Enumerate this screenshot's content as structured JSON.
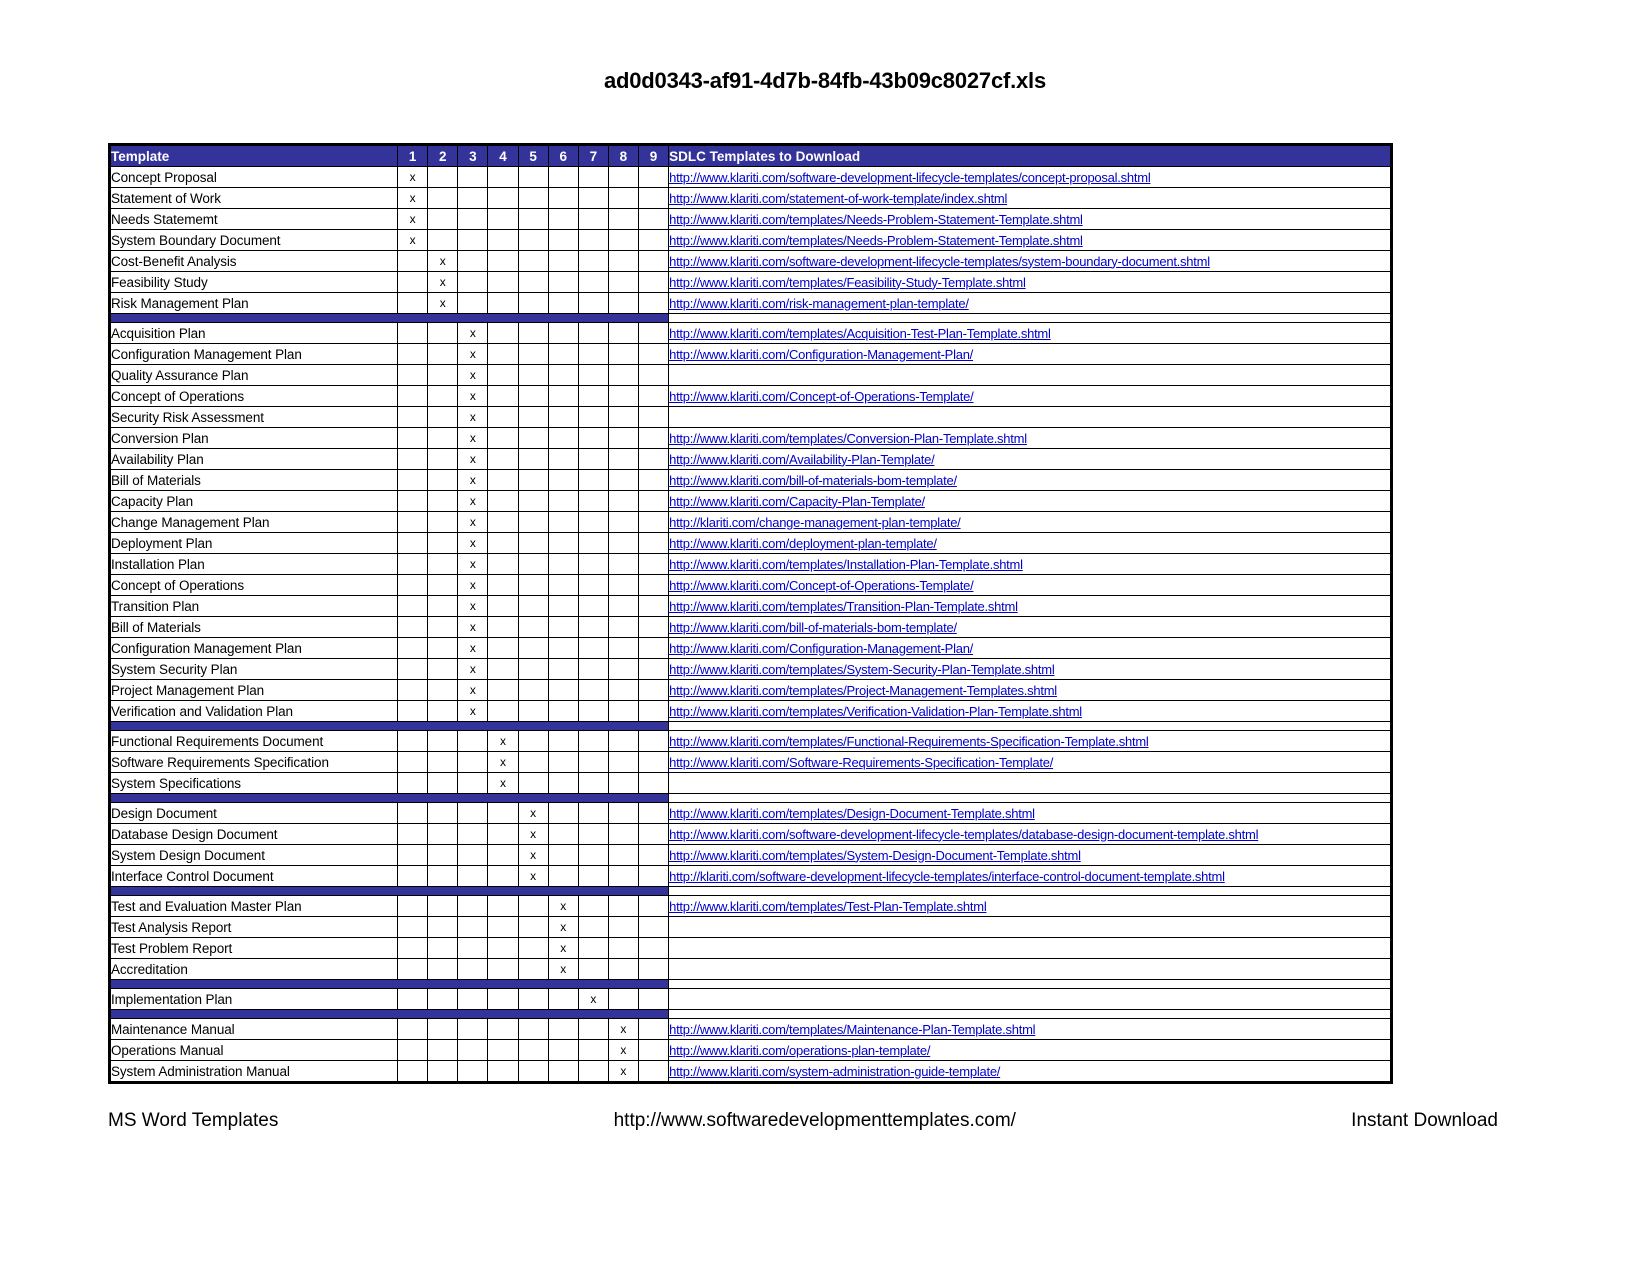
{
  "document": {
    "title": "ad0d0343-af91-4d7b-84fb-43b09c8027cf.xls"
  },
  "table": {
    "headers": {
      "template": "Template",
      "phases": [
        "1",
        "2",
        "3",
        "4",
        "5",
        "6",
        "7",
        "8",
        "9"
      ],
      "links": "SDLC Templates to Download"
    },
    "accent_header_color": "#333399",
    "link_color": "#0000cc",
    "rows": [
      {
        "type": "data",
        "name": "Concept Proposal",
        "phase": 1,
        "url": "http://www.klariti.com/software-development-lifecycle-templates/concept-proposal.shtml"
      },
      {
        "type": "data",
        "name": "Statement of Work",
        "phase": 1,
        "url": "http://www.klariti.com/statement-of-work-template/index.shtml"
      },
      {
        "type": "data",
        "name": "Needs Statememt",
        "phase": 1,
        "url": "http://www.klariti.com/templates/Needs-Problem-Statement-Template.shtml"
      },
      {
        "type": "data",
        "name": "System Boundary Document",
        "phase": 1,
        "url": "http://www.klariti.com/templates/Needs-Problem-Statement-Template.shtml"
      },
      {
        "type": "data",
        "name": "Cost-Benefit Analysis",
        "phase": 2,
        "url": "http://www.klariti.com/software-development-lifecycle-templates/system-boundary-document.shtml"
      },
      {
        "type": "data",
        "name": "Feasibility Study",
        "phase": 2,
        "url": "http://www.klariti.com/templates/Feasibility-Study-Template.shtml"
      },
      {
        "type": "data",
        "name": "Risk Management Plan",
        "phase": 2,
        "url": "http://www.klariti.com/risk-management-plan-template/"
      },
      {
        "type": "separator"
      },
      {
        "type": "data",
        "name": "Acquisition Plan",
        "phase": 3,
        "url": "http://www.klariti.com/templates/Acquisition-Test-Plan-Template.shtml"
      },
      {
        "type": "data",
        "name": "Configuration Management Plan",
        "phase": 3,
        "url": "http://www.klariti.com/Configuration-Management-Plan/"
      },
      {
        "type": "data",
        "name": "Quality Assurance Plan",
        "phase": 3,
        "url": ""
      },
      {
        "type": "data",
        "name": "Concept of Operations",
        "phase": 3,
        "url": "http://www.klariti.com/Concept-of-Operations-Template/"
      },
      {
        "type": "data",
        "name": "Security Risk Assessment",
        "phase": 3,
        "url": ""
      },
      {
        "type": "data",
        "name": "Conversion Plan",
        "phase": 3,
        "url": "http://www.klariti.com/templates/Conversion-Plan-Template.shtml"
      },
      {
        "type": "data",
        "name": "Availability Plan",
        "phase": 3,
        "url": "http://www.klariti.com/Availability-Plan-Template/"
      },
      {
        "type": "data",
        "name": "Bill of Materials",
        "phase": 3,
        "url": "http://www.klariti.com/bill-of-materials-bom-template/"
      },
      {
        "type": "data",
        "name": "Capacity Plan",
        "phase": 3,
        "url": "http://www.klariti.com/Capacity-Plan-Template/"
      },
      {
        "type": "data",
        "name": "Change Management Plan",
        "phase": 3,
        "url": "http://klariti.com/change-management-plan-template/"
      },
      {
        "type": "data",
        "name": "Deployment Plan",
        "phase": 3,
        "url": "http://www.klariti.com/deployment-plan-template/"
      },
      {
        "type": "data",
        "name": "Installation Plan",
        "phase": 3,
        "url": "http://www.klariti.com/templates/Installation-Plan-Template.shtml"
      },
      {
        "type": "data",
        "name": "Concept of Operations",
        "phase": 3,
        "url": "http://www.klariti.com/Concept-of-Operations-Template/"
      },
      {
        "type": "data",
        "name": "Transition Plan",
        "phase": 3,
        "url": "http://www.klariti.com/templates/Transition-Plan-Template.shtml"
      },
      {
        "type": "data",
        "name": "Bill of Materials",
        "phase": 3,
        "url": "http://www.klariti.com/bill-of-materials-bom-template/"
      },
      {
        "type": "data",
        "name": "Configuration Management Plan",
        "phase": 3,
        "url": "http://www.klariti.com/Configuration-Management-Plan/"
      },
      {
        "type": "data",
        "name": "System Security Plan",
        "phase": 3,
        "url": "http://www.klariti.com/templates/System-Security-Plan-Template.shtml"
      },
      {
        "type": "data",
        "name": "Project Management Plan",
        "phase": 3,
        "url": "http://www.klariti.com/templates/Project-Management-Templates.shtml"
      },
      {
        "type": "data",
        "name": "Verification and Validation Plan",
        "phase": 3,
        "url": "http://www.klariti.com/templates/Verification-Validation-Plan-Template.shtml"
      },
      {
        "type": "separator"
      },
      {
        "type": "data",
        "name": "Functional Requirements Document",
        "phase": 4,
        "url": "http://www.klariti.com/templates/Functional-Requirements-Specification-Template.shtml"
      },
      {
        "type": "data",
        "name": "Software Requirements Specification",
        "phase": 4,
        "url": "http://www.klariti.com/Software-Requirements-Specification-Template/"
      },
      {
        "type": "data",
        "name": "System Specifications",
        "phase": 4,
        "url": ""
      },
      {
        "type": "separator"
      },
      {
        "type": "data",
        "name": "Design Document",
        "phase": 5,
        "url": "http://www.klariti.com/templates/Design-Document-Template.shtml"
      },
      {
        "type": "data",
        "name": "Database Design Document",
        "phase": 5,
        "url": "http://www.klariti.com/software-development-lifecycle-templates/database-design-document-template.shtml"
      },
      {
        "type": "data",
        "name": "System Design Document",
        "phase": 5,
        "url": "http://www.klariti.com/templates/System-Design-Document-Template.shtml"
      },
      {
        "type": "data",
        "name": "Interface Control Document",
        "phase": 5,
        "url": "http://klariti.com/software-development-lifecycle-templates/interface-control-document-template.shtml"
      },
      {
        "type": "separator"
      },
      {
        "type": "data",
        "name": "Test and Evaluation Master Plan",
        "phase": 6,
        "url": "http://www.klariti.com/templates/Test-Plan-Template.shtml"
      },
      {
        "type": "data",
        "name": "Test Analysis Report",
        "phase": 6,
        "url": ""
      },
      {
        "type": "data",
        "name": "Test Problem Report",
        "phase": 6,
        "url": ""
      },
      {
        "type": "data",
        "name": "Accreditation",
        "phase": 6,
        "url": ""
      },
      {
        "type": "separator"
      },
      {
        "type": "data",
        "name": "Implementation Plan",
        "phase": 7,
        "url": ""
      },
      {
        "type": "separator"
      },
      {
        "type": "data",
        "name": "Maintenance Manual",
        "phase": 8,
        "url": "http://www.klariti.com/templates/Maintenance-Plan-Template.shtml"
      },
      {
        "type": "data",
        "name": "Operations Manual",
        "phase": 8,
        "url": "http://www.klariti.com/operations-plan-template/"
      },
      {
        "type": "data",
        "name": "System Administration Manual",
        "phase": 8,
        "url": "http://www.klariti.com/system-administration-guide-template/"
      }
    ],
    "mark": "x"
  },
  "footer": {
    "left": "MS Word Templates",
    "center": "http://www.softwaredevelopmenttemplates.com/",
    "right": "Instant Download"
  }
}
